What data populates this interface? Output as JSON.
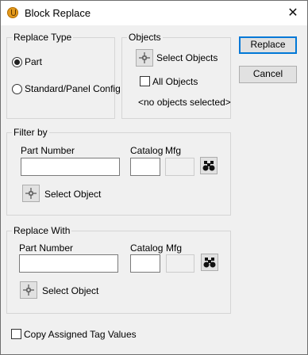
{
  "window": {
    "title": "Block Replace",
    "close_glyph": "✕"
  },
  "replace_type": {
    "label": "Replace Type",
    "options": [
      {
        "label": "Part",
        "checked": true
      },
      {
        "label": "Standard/Panel Config",
        "checked": false
      }
    ]
  },
  "objects": {
    "label": "Objects",
    "select_button": "Select Objects",
    "all_objects": {
      "label": "All Objects",
      "checked": false
    },
    "status": "<no objects selected>"
  },
  "buttons": {
    "replace": "Replace",
    "cancel": "Cancel"
  },
  "filter_by": {
    "label": "Filter by",
    "part_number_label": "Part Number",
    "part_number_value": "",
    "catalog_label": "Catalog",
    "catalog_value": "",
    "mfg_label": "Mfg",
    "mfg_value": "",
    "select_object": "Select Object"
  },
  "replace_with": {
    "label": "Replace With",
    "part_number_label": "Part Number",
    "part_number_value": "",
    "catalog_label": "Catalog",
    "catalog_value": "",
    "mfg_label": "Mfg",
    "mfg_value": "",
    "select_object": "Select Object"
  },
  "copy_tags": {
    "label": "Copy Assigned Tag Values",
    "checked": false
  },
  "icons": {
    "app": "block-replace-app-icon",
    "pick": "crosshair-pick-icon",
    "find": "binoculars-icon",
    "close": "close-icon"
  }
}
